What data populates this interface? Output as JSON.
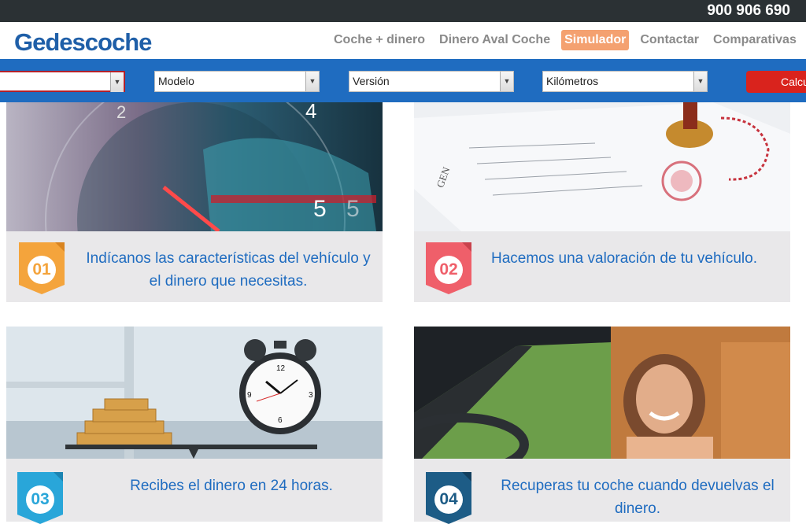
{
  "phone": "900 906 690",
  "logo": "Gedescoche",
  "nav": [
    "Coche + dinero",
    "Dinero Aval Coche",
    "Simulador",
    "Contactar",
    "Comparativas"
  ],
  "filters": {
    "marca": "",
    "modelo": "Modelo",
    "version": "Versión",
    "kilometros": "Kilómetros",
    "calc_button": "Calcu"
  },
  "steps": [
    {
      "number": "01",
      "text": "Indícanos las características del vehículo y el dinero que necesitas."
    },
    {
      "number": "02",
      "text": "Hacemos una valoración de tu vehículo."
    },
    {
      "number": "03",
      "text": "Recibes el dinero en 24 horas."
    },
    {
      "number": "04",
      "text": "Recuperas tu coche cuando devuelvas el dinero."
    }
  ],
  "colors": {
    "brand_blue": "#1f6cc0",
    "active_nav": "#f4a170",
    "badge_01": "#f4a43c",
    "badge_02": "#ef5f6a",
    "badge_03": "#29a6d9",
    "badge_04": "#1d5c86",
    "calc_red": "#d9231d"
  },
  "icons": [
    "speedometer-image",
    "contract-stamp-image",
    "coins-clock-scale-image",
    "woman-in-car-image",
    "select-arrow-icon"
  ]
}
